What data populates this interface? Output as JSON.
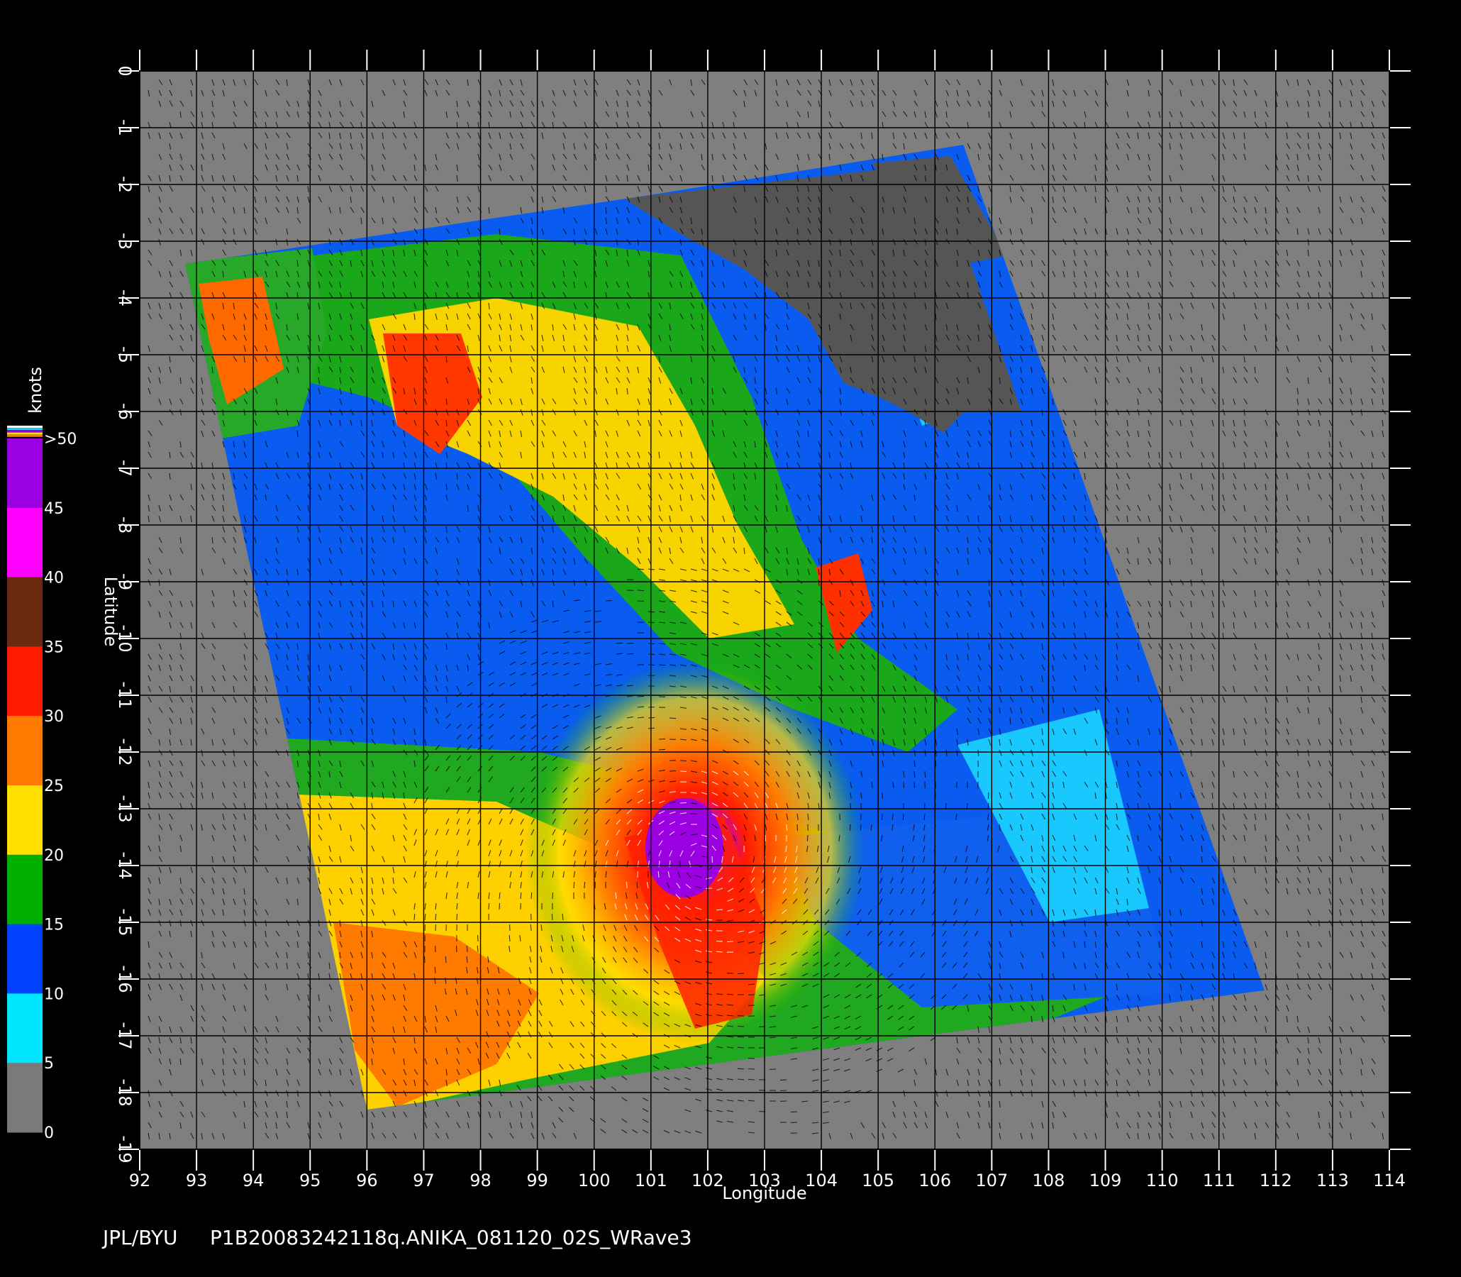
{
  "map": {
    "xlabel": "Longitude",
    "ylabel": "Latitude",
    "lon_range": [
      92,
      114
    ],
    "lat_range": [
      0,
      -19
    ],
    "lon_ticks": [
      "92",
      "93",
      "94",
      "95",
      "96",
      "97",
      "98",
      "99",
      "100",
      "101",
      "102",
      "103",
      "104",
      "105",
      "106",
      "107",
      "108",
      "109",
      "110",
      "111",
      "112",
      "113",
      "114"
    ],
    "lat_ticks": [
      "0",
      "-1",
      "-2",
      "-3",
      "-4",
      "-5",
      "-6",
      "-7",
      "-8",
      "-9",
      "-10",
      "-11",
      "-12",
      "-13",
      "-14",
      "-15",
      "-16",
      "-17",
      "-18",
      "-19"
    ],
    "swath_corners_lonlat": [
      [
        92.8,
        -3.4
      ],
      [
        100.9,
        -2.2
      ],
      [
        106.5,
        -1.3
      ],
      [
        111.8,
        -16.2
      ],
      [
        96.0,
        -18.3
      ]
    ],
    "storm_center_lonlat": [
      101.9,
      -13.9
    ],
    "background_color": "#7f7f7f",
    "land_color": "#555555"
  },
  "colorbar": {
    "unit_label": "knots",
    "labels": [
      ">50",
      "45",
      "40",
      "35",
      "30",
      "25",
      "20",
      "15",
      "10",
      "5",
      "0"
    ],
    "colors": {
      "0-5": "#7a7a7a",
      "5-10": "#00e6ff",
      "10-15": "#0040ff",
      "15-20": "#00b000",
      "20-25": "#ffe000",
      "25-30": "#ff7a00",
      "30-35": "#ff1a00",
      "35-40": "#6a2a10",
      "40-45": "#ff00ff",
      "45-50": "#9a00e0"
    }
  },
  "footer": {
    "source": "JPL/BYU",
    "filename": "P1B20083242118q.ANIKA_081120_02S_WRave3"
  }
}
